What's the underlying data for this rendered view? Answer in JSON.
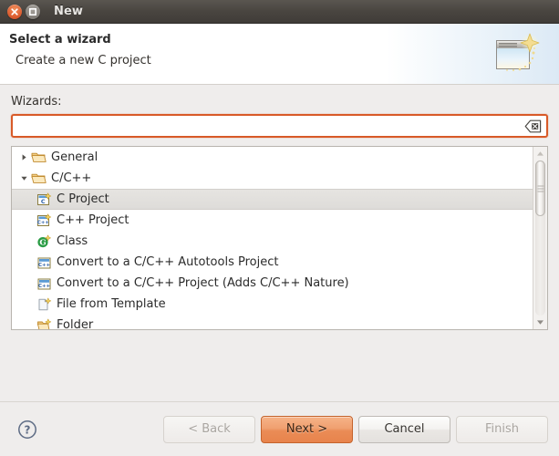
{
  "window": {
    "title": "New",
    "close_icon": "close-icon",
    "maximize_icon": "maximize-icon"
  },
  "banner": {
    "title": "Select a wizard",
    "subtitle": "Create a new C project",
    "icon": "wizard-window-sparkle-icon"
  },
  "form": {
    "wizards_label": "Wizards:",
    "search_value": "",
    "search_placeholder": "",
    "clear_icon": "clear-field-icon"
  },
  "tree": {
    "items": [
      {
        "label": "General",
        "level": 0,
        "expanded": false,
        "twisty": "chevron-right-icon",
        "icon": "folder-icon",
        "selected": false
      },
      {
        "label": "C/C++",
        "level": 0,
        "expanded": true,
        "twisty": "chevron-down-icon",
        "icon": "folder-icon",
        "selected": false
      },
      {
        "label": "C Project",
        "level": 1,
        "icon": "c-project-icon",
        "selected": true
      },
      {
        "label": "C++ Project",
        "level": 1,
        "icon": "cpp-project-icon",
        "selected": false
      },
      {
        "label": "Class",
        "level": 1,
        "icon": "class-icon",
        "selected": false
      },
      {
        "label": "Convert to a C/C++ Autotools Project",
        "level": 1,
        "icon": "convert-cpp-icon",
        "selected": false
      },
      {
        "label": "Convert to a C/C++ Project (Adds C/C++ Nature)",
        "level": 1,
        "icon": "convert-cpp-icon",
        "selected": false
      },
      {
        "label": "File from Template",
        "level": 1,
        "icon": "file-template-icon",
        "selected": false
      },
      {
        "label": "Folder",
        "level": 1,
        "icon": "new-folder-icon",
        "selected": false
      }
    ],
    "scrollbar": {
      "up_icon": "scroll-up-arrow-icon",
      "down_icon": "scroll-down-arrow-icon"
    }
  },
  "footer": {
    "help_icon": "help-question-icon",
    "buttons": [
      {
        "label": "< Back",
        "state": "disabled",
        "name": "back-button"
      },
      {
        "label": "Next >",
        "state": "primary",
        "name": "next-button"
      },
      {
        "label": "Cancel",
        "state": "normal",
        "name": "cancel-button"
      },
      {
        "label": "Finish",
        "state": "disabled",
        "name": "finish-button"
      }
    ]
  },
  "colors": {
    "accent_orange": "#e8834c",
    "focus_border": "#d85a28",
    "titlebar": "#494540",
    "close_button": "#e2683a",
    "selection": "#e6e4e1"
  }
}
